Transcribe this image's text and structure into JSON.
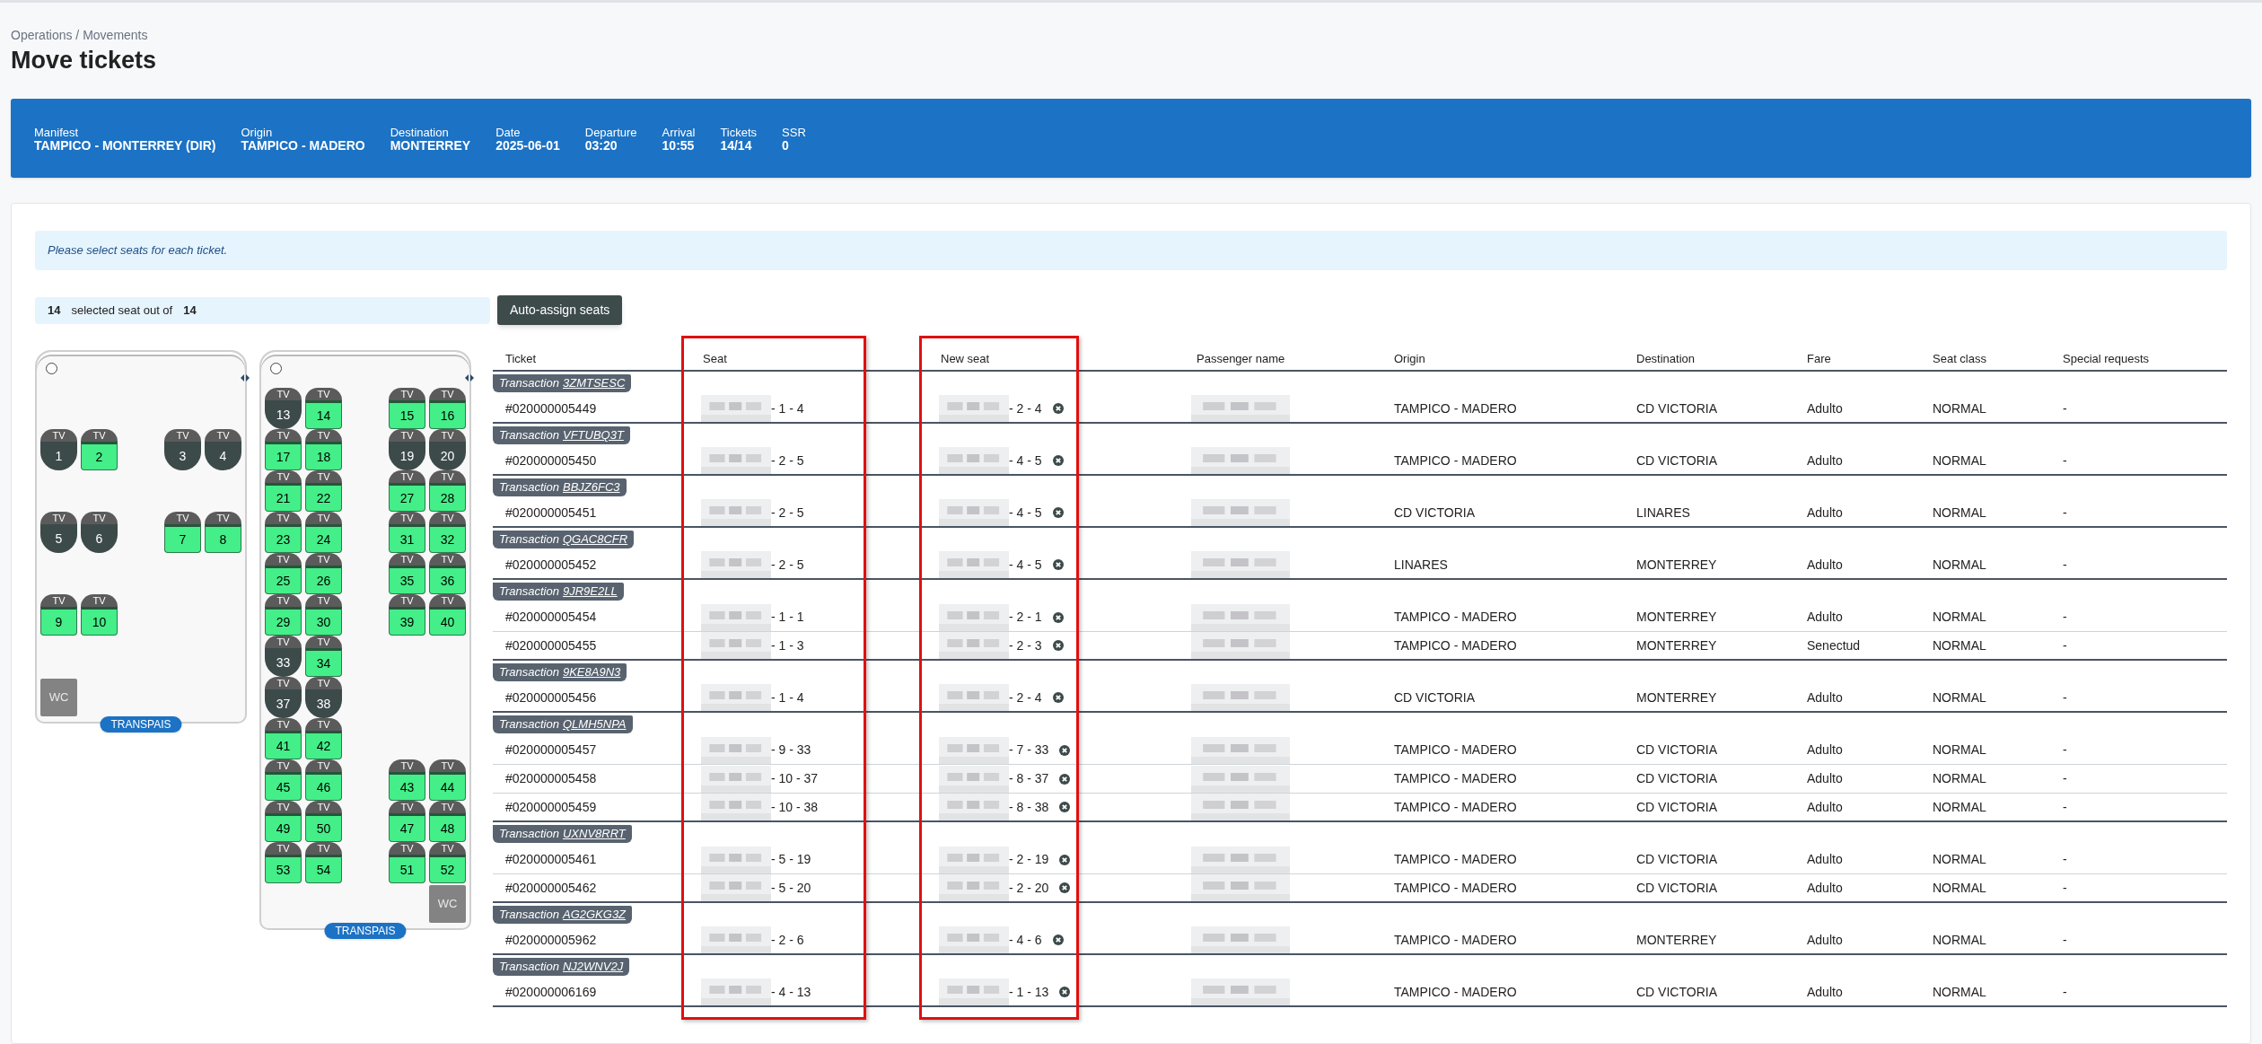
{
  "breadcrumb": "Operations / Movements",
  "title": "Move tickets",
  "trip": [
    {
      "label": "Manifest",
      "value": "TAMPICO - MONTERREY (DIR)"
    },
    {
      "label": "Origin",
      "value": "TAMPICO - MADERO"
    },
    {
      "label": "Destination",
      "value": "MONTERREY"
    },
    {
      "label": "Date",
      "value": "2025-06-01"
    },
    {
      "label": "Departure",
      "value": "03:20"
    },
    {
      "label": "Arrival",
      "value": "10:55"
    },
    {
      "label": "Tickets",
      "value": "14/14"
    },
    {
      "label": "SSR",
      "value": "0"
    }
  ],
  "notice": "Please select seats for each ticket.",
  "selection": {
    "selected": "14",
    "text": "selected seat out of",
    "total": "14"
  },
  "auto_assign_button": "Auto-assign seats",
  "decks": [
    {
      "operator": "TRANSPAIS",
      "rows": [
        {
          "kind": "gap"
        },
        {
          "kind": "seats",
          "left": [
            {
              "number": "1",
              "tag": "TV",
              "occupied": true
            },
            {
              "number": "2",
              "tag": "TV",
              "occupied": false
            }
          ],
          "right": [
            {
              "number": "3",
              "tag": "TV",
              "occupied": true
            },
            {
              "number": "4",
              "tag": "TV",
              "occupied": true
            }
          ]
        },
        {
          "kind": "gap"
        },
        {
          "kind": "seats",
          "left": [
            {
              "number": "5",
              "tag": "TV",
              "occupied": true
            },
            {
              "number": "6",
              "tag": "TV",
              "occupied": true
            }
          ],
          "right": [
            {
              "number": "7",
              "tag": "TV",
              "occupied": false
            },
            {
              "number": "8",
              "tag": "TV",
              "occupied": false
            }
          ]
        },
        {
          "kind": "gap"
        },
        {
          "kind": "seats",
          "left": [
            {
              "number": "9",
              "tag": "TV",
              "occupied": false
            },
            {
              "number": "10",
              "tag": "TV",
              "occupied": false
            }
          ]
        },
        {
          "kind": "gap"
        },
        {
          "kind": "wc",
          "left": {
            "label": "WC"
          }
        }
      ]
    },
    {
      "operator": "TRANSPAIS",
      "rows": [
        {
          "kind": "seats",
          "left": [
            {
              "number": "13",
              "tag": "TV",
              "occupied": true
            },
            {
              "number": "14",
              "tag": "TV",
              "occupied": false
            }
          ],
          "right": [
            {
              "number": "15",
              "tag": "TV",
              "occupied": false
            },
            {
              "number": "16",
              "tag": "TV",
              "occupied": false
            }
          ]
        },
        {
          "kind": "seats",
          "left": [
            {
              "number": "17",
              "tag": "TV",
              "occupied": false
            },
            {
              "number": "18",
              "tag": "TV",
              "occupied": false
            }
          ],
          "right": [
            {
              "number": "19",
              "tag": "TV",
              "occupied": true
            },
            {
              "number": "20",
              "tag": "TV",
              "occupied": true
            }
          ]
        },
        {
          "kind": "seats",
          "left": [
            {
              "number": "21",
              "tag": "TV",
              "occupied": false
            },
            {
              "number": "22",
              "tag": "TV",
              "occupied": false
            }
          ],
          "right": [
            {
              "number": "27",
              "tag": "TV",
              "occupied": false
            },
            {
              "number": "28",
              "tag": "TV",
              "occupied": false
            }
          ]
        },
        {
          "kind": "seats",
          "left": [
            {
              "number": "23",
              "tag": "TV",
              "occupied": false
            },
            {
              "number": "24",
              "tag": "TV",
              "occupied": false
            }
          ],
          "right": [
            {
              "number": "31",
              "tag": "TV",
              "occupied": false
            },
            {
              "number": "32",
              "tag": "TV",
              "occupied": false
            }
          ]
        },
        {
          "kind": "seats",
          "left": [
            {
              "number": "25",
              "tag": "TV",
              "occupied": false
            },
            {
              "number": "26",
              "tag": "TV",
              "occupied": false
            }
          ],
          "right": [
            {
              "number": "35",
              "tag": "TV",
              "occupied": false
            },
            {
              "number": "36",
              "tag": "TV",
              "occupied": false
            }
          ]
        },
        {
          "kind": "seats",
          "left": [
            {
              "number": "29",
              "tag": "TV",
              "occupied": false
            },
            {
              "number": "30",
              "tag": "TV",
              "occupied": false
            }
          ],
          "right": [
            {
              "number": "39",
              "tag": "TV",
              "occupied": false
            },
            {
              "number": "40",
              "tag": "TV",
              "occupied": false
            }
          ]
        },
        {
          "kind": "seats",
          "left": [
            {
              "number": "33",
              "tag": "TV",
              "occupied": true
            },
            {
              "number": "34",
              "tag": "TV",
              "occupied": false
            }
          ]
        },
        {
          "kind": "seats",
          "left": [
            {
              "number": "37",
              "tag": "TV",
              "occupied": true
            },
            {
              "number": "38",
              "tag": "TV",
              "occupied": true
            }
          ]
        },
        {
          "kind": "seats",
          "left": [
            {
              "number": "41",
              "tag": "TV",
              "occupied": false
            },
            {
              "number": "42",
              "tag": "TV",
              "occupied": false
            }
          ]
        },
        {
          "kind": "seats",
          "left": [
            {
              "number": "45",
              "tag": "TV",
              "occupied": false
            },
            {
              "number": "46",
              "tag": "TV",
              "occupied": false
            }
          ],
          "right": [
            {
              "number": "43",
              "tag": "TV",
              "occupied": false
            },
            {
              "number": "44",
              "tag": "TV",
              "occupied": false
            }
          ]
        },
        {
          "kind": "seats",
          "left": [
            {
              "number": "49",
              "tag": "TV",
              "occupied": false
            },
            {
              "number": "50",
              "tag": "TV",
              "occupied": false
            }
          ],
          "right": [
            {
              "number": "47",
              "tag": "TV",
              "occupied": false
            },
            {
              "number": "48",
              "tag": "TV",
              "occupied": false
            }
          ]
        },
        {
          "kind": "seats",
          "left": [
            {
              "number": "53",
              "tag": "TV",
              "occupied": false
            },
            {
              "number": "54",
              "tag": "TV",
              "occupied": false
            }
          ],
          "right": [
            {
              "number": "51",
              "tag": "TV",
              "occupied": false
            },
            {
              "number": "52",
              "tag": "TV",
              "occupied": false
            }
          ]
        },
        {
          "kind": "wc",
          "right": {
            "label": "WC"
          }
        }
      ]
    }
  ],
  "table": {
    "columns": [
      {
        "label": "Ticket",
        "highlighted": false
      },
      {
        "label": "Seat",
        "highlighted": true
      },
      {
        "label": "New seat",
        "highlighted": true
      },
      {
        "label": "Passenger name",
        "highlighted": false
      },
      {
        "label": "Origin",
        "highlighted": false
      },
      {
        "label": "Destination",
        "highlighted": false
      },
      {
        "label": "Fare",
        "highlighted": false
      },
      {
        "label": "Seat class",
        "highlighted": false
      },
      {
        "label": "Special requests",
        "highlighted": false
      }
    ],
    "transactions": [
      {
        "label": "Transaction",
        "code": "3ZMTSESC",
        "tickets": [
          {
            "ticket": "#020000005449",
            "seat": "- 1 - 4",
            "new_seat": "- 2 - 4",
            "origin": "TAMPICO - MADERO",
            "destination": "CD VICTORIA",
            "fare": "Adulto",
            "seat_class": "NORMAL",
            "special": "-"
          }
        ]
      },
      {
        "label": "Transaction",
        "code": "VFTUBQ3T",
        "tickets": [
          {
            "ticket": "#020000005450",
            "seat": "- 2 - 5",
            "new_seat": "- 4 - 5",
            "origin": "TAMPICO - MADERO",
            "destination": "CD VICTORIA",
            "fare": "Adulto",
            "seat_class": "NORMAL",
            "special": "-"
          }
        ]
      },
      {
        "label": "Transaction",
        "code": "BBJZ6FC3",
        "tickets": [
          {
            "ticket": "#020000005451",
            "seat": "- 2 - 5",
            "new_seat": "- 4 - 5",
            "origin": "CD VICTORIA",
            "destination": "LINARES",
            "fare": "Adulto",
            "seat_class": "NORMAL",
            "special": "-"
          }
        ]
      },
      {
        "label": "Transaction",
        "code": "QGAC8CFR",
        "tickets": [
          {
            "ticket": "#020000005452",
            "seat": "- 2 - 5",
            "new_seat": "- 4 - 5",
            "origin": "LINARES",
            "destination": "MONTERREY",
            "fare": "Adulto",
            "seat_class": "NORMAL",
            "special": "-"
          }
        ]
      },
      {
        "label": "Transaction",
        "code": "9JR9E2LL",
        "tickets": [
          {
            "ticket": "#020000005454",
            "seat": "- 1 - 1",
            "new_seat": "- 2 - 1",
            "origin": "TAMPICO - MADERO",
            "destination": "MONTERREY",
            "fare": "Adulto",
            "seat_class": "NORMAL",
            "special": "-"
          },
          {
            "ticket": "#020000005455",
            "seat": "- 1 - 3",
            "new_seat": "- 2 - 3",
            "origin": "TAMPICO - MADERO",
            "destination": "MONTERREY",
            "fare": "Senectud",
            "seat_class": "NORMAL",
            "special": "-"
          }
        ]
      },
      {
        "label": "Transaction",
        "code": "9KE8A9N3",
        "tickets": [
          {
            "ticket": "#020000005456",
            "seat": "- 1 - 4",
            "new_seat": "- 2 - 4",
            "origin": "CD VICTORIA",
            "destination": "MONTERREY",
            "fare": "Adulto",
            "seat_class": "NORMAL",
            "special": "-"
          }
        ]
      },
      {
        "label": "Transaction",
        "code": "QLMH5NPA",
        "tickets": [
          {
            "ticket": "#020000005457",
            "seat": "- 9 - 33",
            "new_seat": "- 7 - 33",
            "origin": "TAMPICO - MADERO",
            "destination": "CD VICTORIA",
            "fare": "Adulto",
            "seat_class": "NORMAL",
            "special": "-"
          },
          {
            "ticket": "#020000005458",
            "seat": "- 10 - 37",
            "new_seat": "- 8 - 37",
            "origin": "TAMPICO - MADERO",
            "destination": "CD VICTORIA",
            "fare": "Adulto",
            "seat_class": "NORMAL",
            "special": "-"
          },
          {
            "ticket": "#020000005459",
            "seat": "- 10 - 38",
            "new_seat": "- 8 - 38",
            "origin": "TAMPICO - MADERO",
            "destination": "CD VICTORIA",
            "fare": "Adulto",
            "seat_class": "NORMAL",
            "special": "-"
          }
        ]
      },
      {
        "label": "Transaction",
        "code": "UXNV8RRT",
        "tickets": [
          {
            "ticket": "#020000005461",
            "seat": "- 5 - 19",
            "new_seat": "- 2 - 19",
            "origin": "TAMPICO - MADERO",
            "destination": "CD VICTORIA",
            "fare": "Adulto",
            "seat_class": "NORMAL",
            "special": "-"
          },
          {
            "ticket": "#020000005462",
            "seat": "- 5 - 20",
            "new_seat": "- 2 - 20",
            "origin": "TAMPICO - MADERO",
            "destination": "CD VICTORIA",
            "fare": "Adulto",
            "seat_class": "NORMAL",
            "special": "-"
          }
        ]
      },
      {
        "label": "Transaction",
        "code": "AG2GKG3Z",
        "tickets": [
          {
            "ticket": "#020000005962",
            "seat": "- 2 - 6",
            "new_seat": "- 4 - 6",
            "origin": "TAMPICO - MADERO",
            "destination": "MONTERREY",
            "fare": "Adulto",
            "seat_class": "NORMAL",
            "special": "-"
          }
        ]
      },
      {
        "label": "Transaction",
        "code": "NJ2WNV2J",
        "tickets": [
          {
            "ticket": "#020000006169",
            "seat": "- 4 - 13",
            "new_seat": "- 1 - 13",
            "origin": "TAMPICO - MADERO",
            "destination": "CD VICTORIA",
            "fare": "Adulto",
            "seat_class": "NORMAL",
            "special": "-"
          }
        ]
      }
    ]
  }
}
